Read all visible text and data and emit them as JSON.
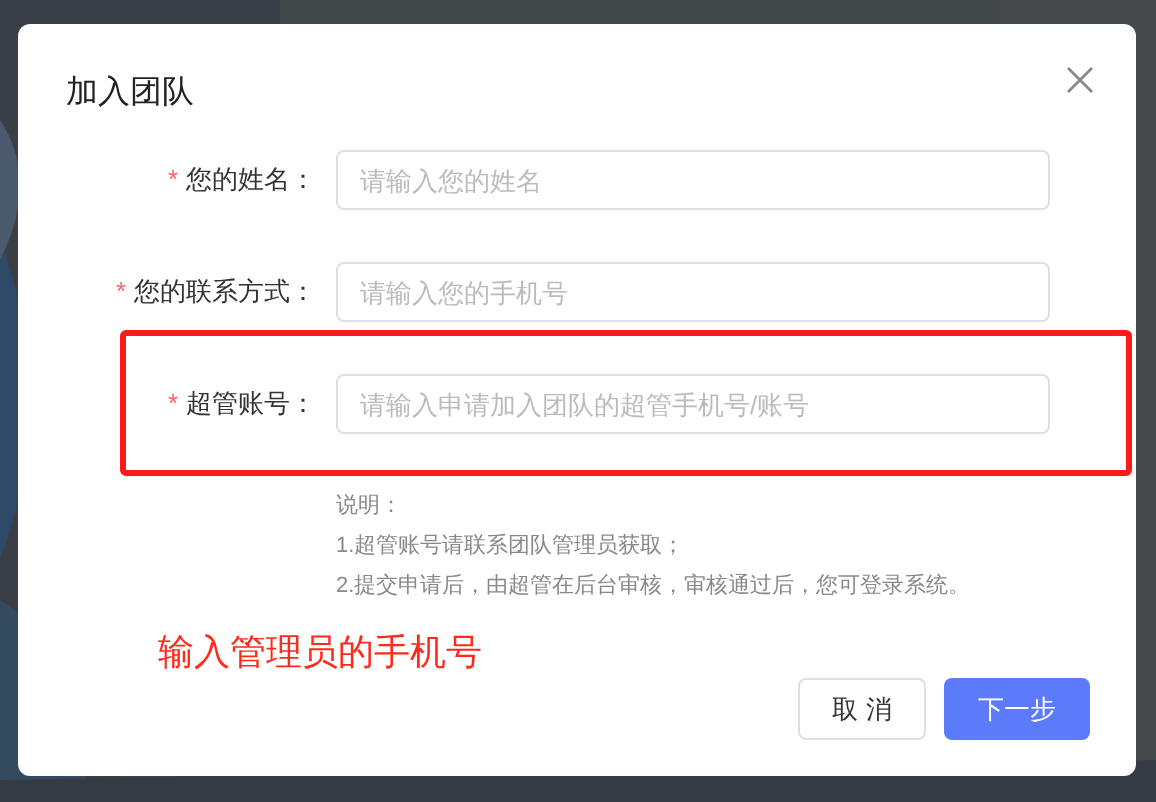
{
  "dialog": {
    "title": "加入团队",
    "required_mark": "*",
    "fields": [
      {
        "label": "您的姓名：",
        "required": true,
        "placeholder": "请输入您的姓名",
        "highlighted": false
      },
      {
        "label": "您的联系方式：",
        "required": true,
        "placeholder": "请输入您的手机号",
        "highlighted": false
      },
      {
        "label": "超管账号：",
        "required": true,
        "placeholder": "请输入申请加入团队的超管手机号/账号",
        "highlighted": true
      }
    ],
    "notes": [
      "说明：",
      "1.超管账号请联系团队管理员获取；",
      "2.提交申请后，由超管在后台审核，审核通过后，您可登录系统。"
    ],
    "annotation": "输入管理员的手机号",
    "buttons": [
      {
        "label": "取 消",
        "kind": "secondary"
      },
      {
        "label": "下一步",
        "kind": "primary"
      }
    ]
  }
}
